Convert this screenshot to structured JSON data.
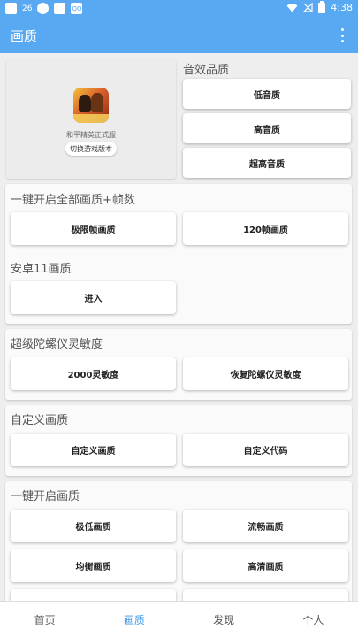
{
  "statusbar": {
    "left_icons": [
      "square-icon",
      "sim-icon",
      "circle-icon",
      "square-icon",
      "image-icon"
    ],
    "sim_label": "26",
    "image_label": "QQ",
    "time": "4:38"
  },
  "appbar": {
    "title": "画质"
  },
  "game": {
    "name": "和平精英正式服",
    "switch_label": "切换游戏版本"
  },
  "audio": {
    "title": "音效品质",
    "buttons": [
      "低音质",
      "高音质",
      "超高音质"
    ]
  },
  "one_key_all": {
    "title": "一键开启全部画质+帧数",
    "buttons": [
      "极限帧画质",
      "120帧画质"
    ]
  },
  "android11": {
    "title": "安卓11画质",
    "buttons": [
      "进入"
    ]
  },
  "gyro": {
    "title": "超级陀螺仪灵敏度",
    "buttons": [
      "2000灵敏度",
      "恢复陀螺仪灵敏度"
    ]
  },
  "custom": {
    "title": "自定义画质",
    "buttons": [
      "自定义画质",
      "自定义代码"
    ]
  },
  "one_key": {
    "title": "一键开启画质",
    "buttons": [
      "极低画质",
      "流畅画质",
      "均衡画质",
      "高清画质"
    ]
  },
  "nav": {
    "items": [
      "首页",
      "画质",
      "发现",
      "个人"
    ],
    "active_index": 1
  },
  "colors": {
    "accent": "#58a9f2",
    "nav_active": "#3d9bea"
  }
}
